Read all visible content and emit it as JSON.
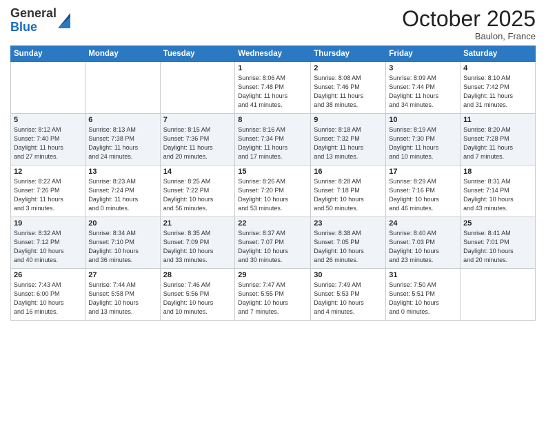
{
  "header": {
    "logo_line1": "General",
    "logo_line2": "Blue",
    "month": "October 2025",
    "location": "Baulon, France"
  },
  "weekdays": [
    "Sunday",
    "Monday",
    "Tuesday",
    "Wednesday",
    "Thursday",
    "Friday",
    "Saturday"
  ],
  "weeks": [
    [
      {
        "day": "",
        "info": ""
      },
      {
        "day": "",
        "info": ""
      },
      {
        "day": "",
        "info": ""
      },
      {
        "day": "1",
        "info": "Sunrise: 8:06 AM\nSunset: 7:48 PM\nDaylight: 11 hours\nand 41 minutes."
      },
      {
        "day": "2",
        "info": "Sunrise: 8:08 AM\nSunset: 7:46 PM\nDaylight: 11 hours\nand 38 minutes."
      },
      {
        "day": "3",
        "info": "Sunrise: 8:09 AM\nSunset: 7:44 PM\nDaylight: 11 hours\nand 34 minutes."
      },
      {
        "day": "4",
        "info": "Sunrise: 8:10 AM\nSunset: 7:42 PM\nDaylight: 11 hours\nand 31 minutes."
      }
    ],
    [
      {
        "day": "5",
        "info": "Sunrise: 8:12 AM\nSunset: 7:40 PM\nDaylight: 11 hours\nand 27 minutes."
      },
      {
        "day": "6",
        "info": "Sunrise: 8:13 AM\nSunset: 7:38 PM\nDaylight: 11 hours\nand 24 minutes."
      },
      {
        "day": "7",
        "info": "Sunrise: 8:15 AM\nSunset: 7:36 PM\nDaylight: 11 hours\nand 20 minutes."
      },
      {
        "day": "8",
        "info": "Sunrise: 8:16 AM\nSunset: 7:34 PM\nDaylight: 11 hours\nand 17 minutes."
      },
      {
        "day": "9",
        "info": "Sunrise: 8:18 AM\nSunset: 7:32 PM\nDaylight: 11 hours\nand 13 minutes."
      },
      {
        "day": "10",
        "info": "Sunrise: 8:19 AM\nSunset: 7:30 PM\nDaylight: 11 hours\nand 10 minutes."
      },
      {
        "day": "11",
        "info": "Sunrise: 8:20 AM\nSunset: 7:28 PM\nDaylight: 11 hours\nand 7 minutes."
      }
    ],
    [
      {
        "day": "12",
        "info": "Sunrise: 8:22 AM\nSunset: 7:26 PM\nDaylight: 11 hours\nand 3 minutes."
      },
      {
        "day": "13",
        "info": "Sunrise: 8:23 AM\nSunset: 7:24 PM\nDaylight: 11 hours\nand 0 minutes."
      },
      {
        "day": "14",
        "info": "Sunrise: 8:25 AM\nSunset: 7:22 PM\nDaylight: 10 hours\nand 56 minutes."
      },
      {
        "day": "15",
        "info": "Sunrise: 8:26 AM\nSunset: 7:20 PM\nDaylight: 10 hours\nand 53 minutes."
      },
      {
        "day": "16",
        "info": "Sunrise: 8:28 AM\nSunset: 7:18 PM\nDaylight: 10 hours\nand 50 minutes."
      },
      {
        "day": "17",
        "info": "Sunrise: 8:29 AM\nSunset: 7:16 PM\nDaylight: 10 hours\nand 46 minutes."
      },
      {
        "day": "18",
        "info": "Sunrise: 8:31 AM\nSunset: 7:14 PM\nDaylight: 10 hours\nand 43 minutes."
      }
    ],
    [
      {
        "day": "19",
        "info": "Sunrise: 8:32 AM\nSunset: 7:12 PM\nDaylight: 10 hours\nand 40 minutes."
      },
      {
        "day": "20",
        "info": "Sunrise: 8:34 AM\nSunset: 7:10 PM\nDaylight: 10 hours\nand 36 minutes."
      },
      {
        "day": "21",
        "info": "Sunrise: 8:35 AM\nSunset: 7:09 PM\nDaylight: 10 hours\nand 33 minutes."
      },
      {
        "day": "22",
        "info": "Sunrise: 8:37 AM\nSunset: 7:07 PM\nDaylight: 10 hours\nand 30 minutes."
      },
      {
        "day": "23",
        "info": "Sunrise: 8:38 AM\nSunset: 7:05 PM\nDaylight: 10 hours\nand 26 minutes."
      },
      {
        "day": "24",
        "info": "Sunrise: 8:40 AM\nSunset: 7:03 PM\nDaylight: 10 hours\nand 23 minutes."
      },
      {
        "day": "25",
        "info": "Sunrise: 8:41 AM\nSunset: 7:01 PM\nDaylight: 10 hours\nand 20 minutes."
      }
    ],
    [
      {
        "day": "26",
        "info": "Sunrise: 7:43 AM\nSunset: 6:00 PM\nDaylight: 10 hours\nand 16 minutes."
      },
      {
        "day": "27",
        "info": "Sunrise: 7:44 AM\nSunset: 5:58 PM\nDaylight: 10 hours\nand 13 minutes."
      },
      {
        "day": "28",
        "info": "Sunrise: 7:46 AM\nSunset: 5:56 PM\nDaylight: 10 hours\nand 10 minutes."
      },
      {
        "day": "29",
        "info": "Sunrise: 7:47 AM\nSunset: 5:55 PM\nDaylight: 10 hours\nand 7 minutes."
      },
      {
        "day": "30",
        "info": "Sunrise: 7:49 AM\nSunset: 5:53 PM\nDaylight: 10 hours\nand 4 minutes."
      },
      {
        "day": "31",
        "info": "Sunrise: 7:50 AM\nSunset: 5:51 PM\nDaylight: 10 hours\nand 0 minutes."
      },
      {
        "day": "",
        "info": ""
      }
    ]
  ]
}
